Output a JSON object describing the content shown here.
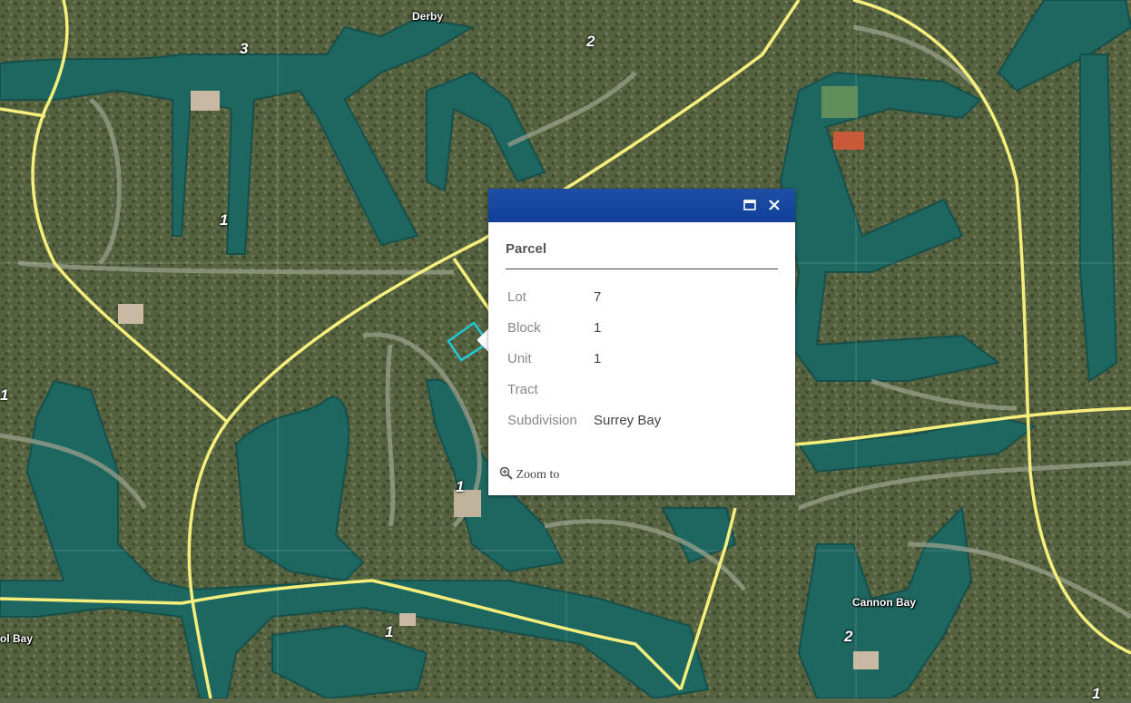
{
  "map": {
    "place_labels": [
      "Derby",
      "Cannon Bay",
      "ol Bay"
    ],
    "unit_numbers": [
      "3",
      "2",
      "1",
      "1",
      "1",
      "2",
      "1",
      "1"
    ],
    "colors": {
      "land": "#4f5e3e",
      "water": "#1f6a63",
      "road": "#f3ec7a",
      "road_casing": "#c9c190",
      "parcel_highlight": "#22c8d8"
    }
  },
  "popup": {
    "title": "Parcel",
    "header_color": "#1849a9",
    "fields": [
      {
        "label": "Lot",
        "value": "7"
      },
      {
        "label": "Block",
        "value": "1"
      },
      {
        "label": "Unit",
        "value": "1"
      },
      {
        "label": "Tract",
        "value": ""
      },
      {
        "label": "Subdivision",
        "value": "Surrey Bay"
      }
    ],
    "zoom_label": "Zoom to",
    "icons": {
      "maximize": "maximize-icon",
      "close": "close-icon",
      "zoom": "zoom-in-icon"
    }
  }
}
